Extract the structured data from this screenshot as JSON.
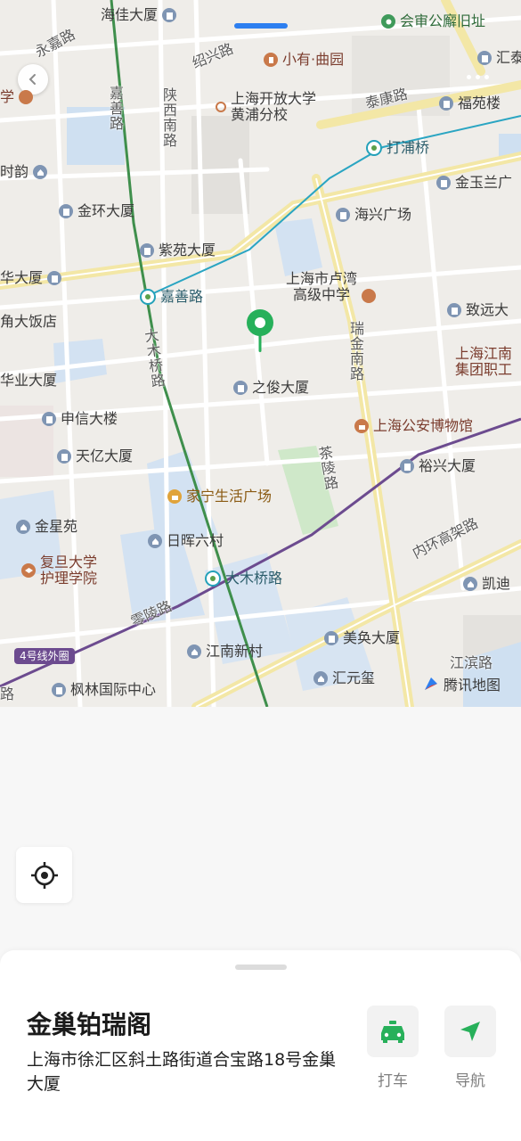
{
  "map": {
    "pois": [
      {
        "name": "海佳大厦",
        "kind": "building"
      },
      {
        "name": "会审公廨旧址",
        "kind": "landmark"
      },
      {
        "name": "汇泰",
        "kind": "building"
      },
      {
        "name": "小有·曲园",
        "kind": "food"
      },
      {
        "name": "上海开放大学\n黄浦分校",
        "kind": "school"
      },
      {
        "name": "福苑楼",
        "kind": "building"
      },
      {
        "name": "学",
        "kind": "school"
      },
      {
        "name": "打浦桥",
        "kind": "metro"
      },
      {
        "name": "时韵",
        "kind": "home"
      },
      {
        "name": "金玉兰广",
        "kind": "building"
      },
      {
        "name": "金环大厦",
        "kind": "building"
      },
      {
        "name": "海兴广场",
        "kind": "building"
      },
      {
        "name": "紫苑大厦",
        "kind": "building"
      },
      {
        "name": "华大厦",
        "kind": "building"
      },
      {
        "name": "上海市卢湾\n高级中学",
        "kind": "school"
      },
      {
        "name": "嘉善路",
        "kind": "metro"
      },
      {
        "name": "致远大",
        "kind": "building"
      },
      {
        "name": "角大饭店",
        "kind": "none"
      },
      {
        "name": "上海江南\n集团职工",
        "kind": "none"
      },
      {
        "name": "华业大厦",
        "kind": "none"
      },
      {
        "name": "之俊大厦",
        "kind": "building"
      },
      {
        "name": "申信大楼",
        "kind": "building"
      },
      {
        "name": "上海公安博物馆",
        "kind": "museum"
      },
      {
        "name": "天亿大厦",
        "kind": "building"
      },
      {
        "name": "裕兴大厦",
        "kind": "building"
      },
      {
        "name": "家宁生活广场",
        "kind": "shop"
      },
      {
        "name": "金星苑",
        "kind": "home"
      },
      {
        "name": "日晖六村",
        "kind": "home"
      },
      {
        "name": "复旦大学\n护理学院",
        "kind": "school"
      },
      {
        "name": "大木桥路",
        "kind": "metro"
      },
      {
        "name": "凯迪",
        "kind": "home"
      },
      {
        "name": "美奂大厦",
        "kind": "building"
      },
      {
        "name": "江南新村",
        "kind": "home"
      },
      {
        "name": "汇元玺",
        "kind": "home"
      },
      {
        "name": "枫林国际中心",
        "kind": "building"
      }
    ],
    "roads": [
      "永嘉路",
      "绍兴路",
      "泰康路",
      "嘉善路",
      "陕西南路",
      "瑞金南路",
      "大木桥路",
      "茶陵路",
      "内环高架路",
      "零陵路",
      "江滨路",
      "路"
    ],
    "line_badge": "4号线外圈",
    "logo_text": "腾讯地图",
    "colors": {
      "metro_line_4": "#6c4b8f",
      "metro_line_9": "#2aa5c2",
      "metro_line_green": "#3f8f4c",
      "pin": "#27b05a",
      "arterial": "#f6ecb0",
      "water": "#cfe0f1",
      "park": "#cfe8c9"
    }
  },
  "place": {
    "name": "金巢铂瑞阁",
    "address": "上海市徐汇区斜土路街道合宝路18号金巢大厦"
  },
  "actions": [
    {
      "label": "打车",
      "icon": "taxi-icon"
    },
    {
      "label": "导航",
      "icon": "navigate-icon"
    }
  ]
}
